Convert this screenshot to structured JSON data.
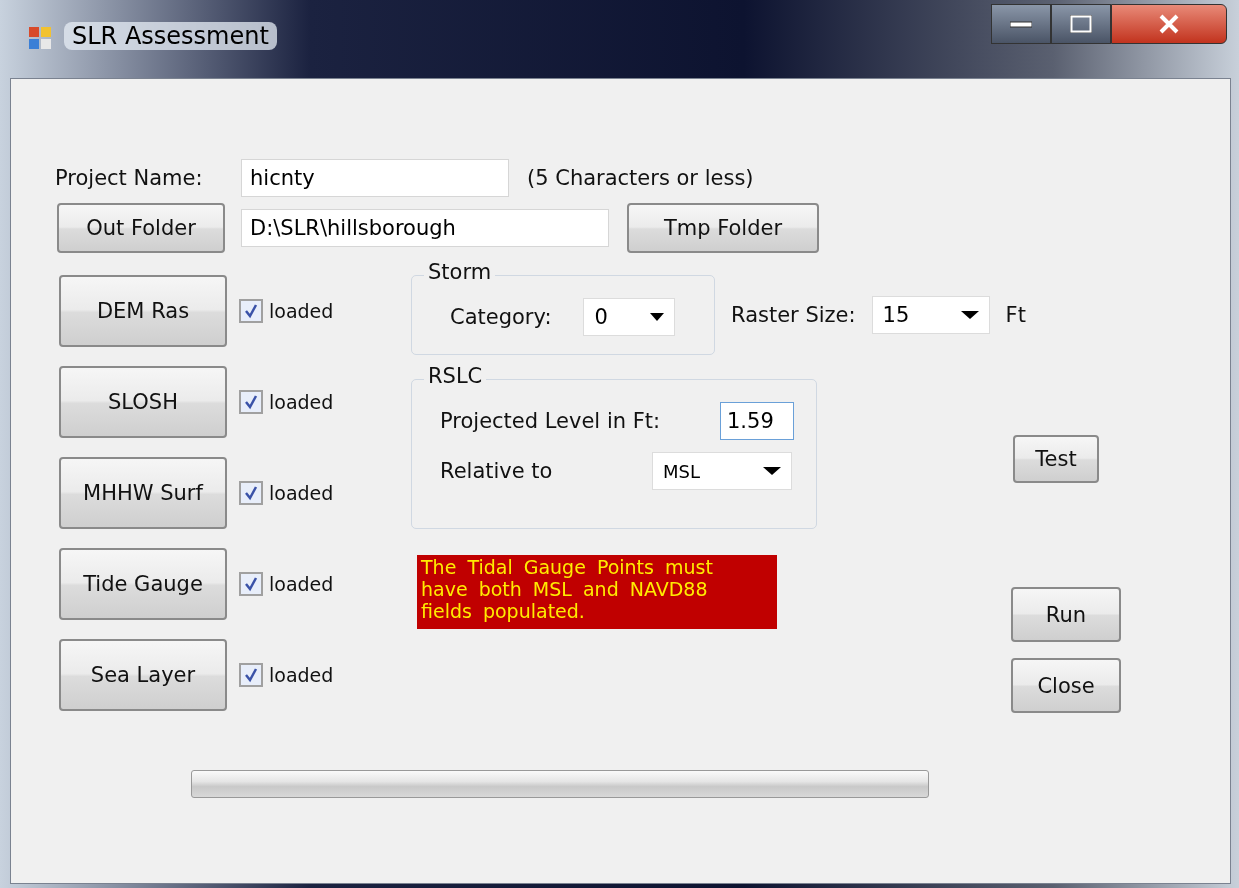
{
  "window": {
    "title": "SLR Assessment"
  },
  "project_name": {
    "label": "Project Name:",
    "value": "hicnty",
    "hint": "(5 Characters or less)"
  },
  "out_folder": {
    "button": "Out Folder",
    "value": "D:\\SLR\\hillsborough",
    "tmp_button": "Tmp Folder"
  },
  "layers": [
    {
      "button": "DEM Ras",
      "label": "loaded",
      "checked": true
    },
    {
      "button": "SLOSH",
      "label": "loaded",
      "checked": true
    },
    {
      "button": "MHHW Surf",
      "label": "loaded",
      "checked": true
    },
    {
      "button": "Tide Gauge",
      "label": "loaded",
      "checked": true
    },
    {
      "button": "Sea Layer",
      "label": "loaded",
      "checked": true
    }
  ],
  "storm": {
    "title": "Storm",
    "category_label": "Category:",
    "category": "0"
  },
  "raster": {
    "label": "Raster Size:",
    "value": "15",
    "unit": "Ft"
  },
  "rslc": {
    "title": "RSLC",
    "level_label": "Projected Level in Ft:",
    "level_value": "1.59",
    "relative_label": "Relative to",
    "relative_value": "MSL"
  },
  "message": "The Tidal Gauge Points must have both MSL and NAVD88 fields populated.",
  "buttons": {
    "test": "Test",
    "run": "Run",
    "close": "Close"
  },
  "progress": {
    "level": 0
  }
}
